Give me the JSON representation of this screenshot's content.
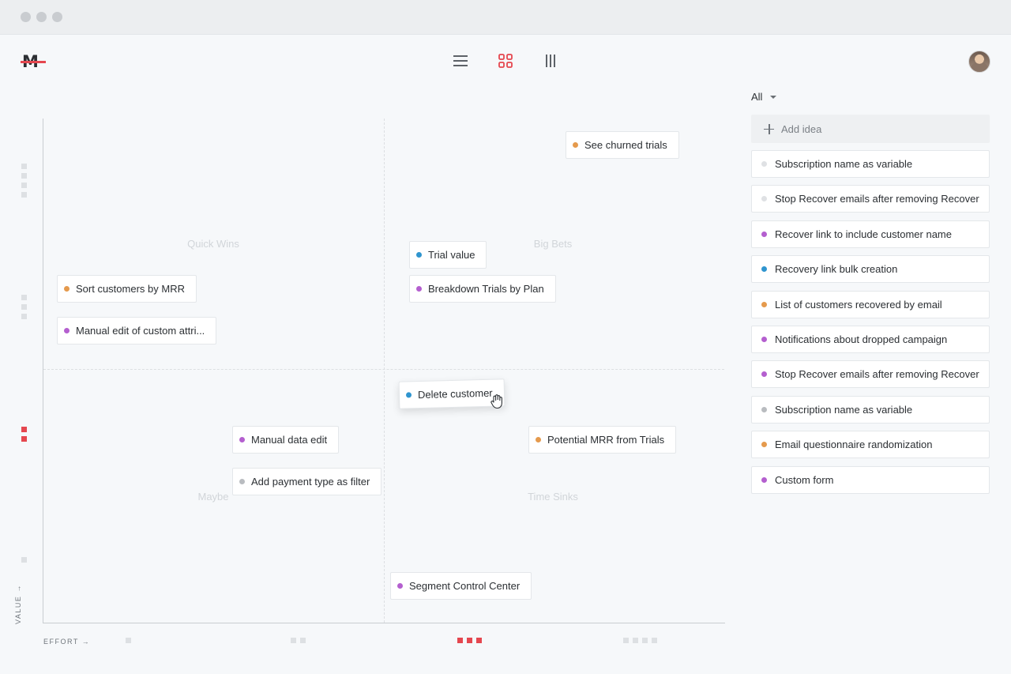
{
  "window": {
    "controls": [
      "close-button",
      "minimize-button",
      "maximize-button"
    ]
  },
  "colors": {
    "purple": "#b45fcf",
    "orange": "#e59a4d",
    "blue": "#2f95cf",
    "gray": "#b9bcc0",
    "light": "#dfe1e4",
    "accent": "#e5474f"
  },
  "header": {
    "logo": "M",
    "views": [
      {
        "name": "list-view",
        "icon": "hamburger-icon",
        "active": false
      },
      {
        "name": "matrix-view",
        "icon": "grid-icon",
        "active": true
      },
      {
        "name": "columns-view",
        "icon": "columns-icon",
        "active": false
      }
    ]
  },
  "matrix": {
    "quadrants": {
      "top_left": "Quick Wins",
      "top_right": "Big Bets",
      "bottom_left": "Maybe",
      "bottom_right": "Time Sinks"
    },
    "y_axis_label": "VALUE →",
    "x_axis_label": "EFFORT →",
    "value_levels": 4,
    "active_value_level": 2,
    "effort_levels": 4,
    "active_effort_level": 3,
    "cards": [
      {
        "label": "See churned trials",
        "color": "orange"
      },
      {
        "label": "Trial value",
        "color": "blue"
      },
      {
        "label": "Sort customers by MRR",
        "color": "orange"
      },
      {
        "label": "Breakdown Trials by Plan",
        "color": "purple"
      },
      {
        "label": "Manual edit of custom attri...",
        "color": "purple"
      },
      {
        "label": "Delete customer",
        "color": "blue",
        "dragging": true
      },
      {
        "label": "Manual data edit",
        "color": "purple"
      },
      {
        "label": "Potential MRR from Trials",
        "color": "orange"
      },
      {
        "label": "Add payment type as filter",
        "color": "gray"
      },
      {
        "label": "Segment Control Center",
        "color": "purple"
      }
    ]
  },
  "sidebar": {
    "filter": "All",
    "add_placeholder": "Add idea",
    "items": [
      {
        "label": "Subscription name as variable",
        "color": "light"
      },
      {
        "label": "Stop Recover emails after removing Recover",
        "color": "light"
      },
      {
        "label": "Recover link to include customer name",
        "color": "purple"
      },
      {
        "label": "Recovery link bulk creation",
        "color": "blue"
      },
      {
        "label": "List of customers recovered by email",
        "color": "orange"
      },
      {
        "label": "Notifications about dropped campaign",
        "color": "purple"
      },
      {
        "label": "Stop Recover emails after removing Recover",
        "color": "purple"
      },
      {
        "label": "Subscription name as variable",
        "color": "gray"
      },
      {
        "label": "Email questionnaire randomization",
        "color": "orange"
      },
      {
        "label": "Custom form",
        "color": "purple"
      }
    ]
  }
}
